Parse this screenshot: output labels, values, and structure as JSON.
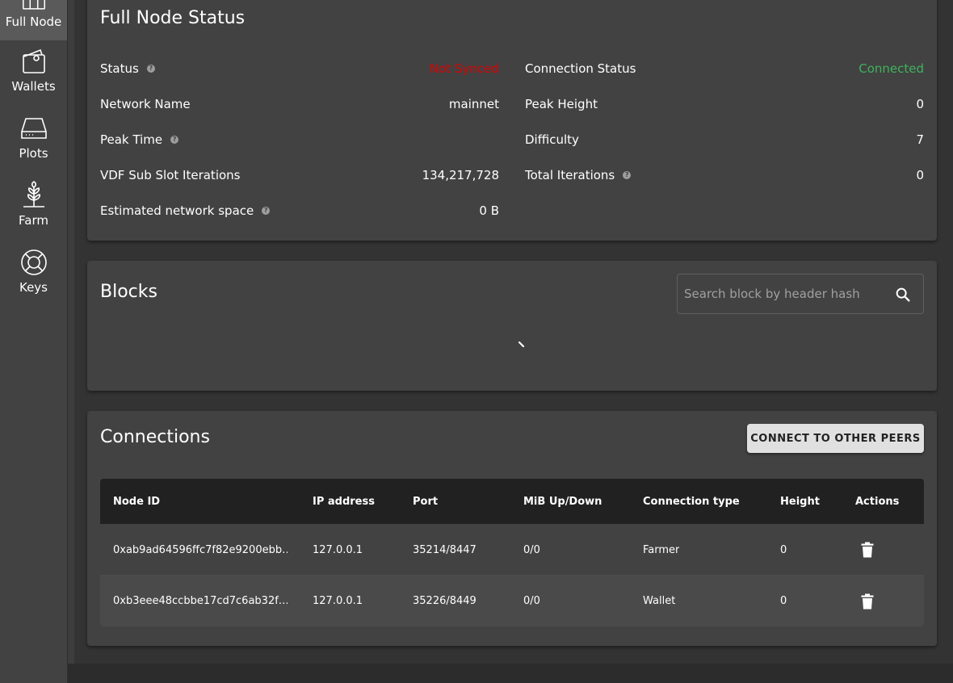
{
  "sidebar": {
    "items": [
      {
        "label": "Full Node",
        "icon": "full-node-icon",
        "active": true
      },
      {
        "label": "Wallets",
        "icon": "wallet-icon"
      },
      {
        "label": "Plots",
        "icon": "hard-drive-icon"
      },
      {
        "label": "Farm",
        "icon": "plant-icon"
      },
      {
        "label": "Keys",
        "icon": "lifebuoy-icon"
      }
    ]
  },
  "status_card": {
    "title": "Full Node Status",
    "left": [
      {
        "label": "Status",
        "value": "Not Synced",
        "help": true
      },
      {
        "label": "Network Name",
        "value": "mainnet"
      },
      {
        "label": "Peak Time",
        "value": "",
        "help": true
      },
      {
        "label": "VDF Sub Slot Iterations",
        "value": "134,217,728"
      },
      {
        "label": "Estimated network space",
        "value": "0 B",
        "help": true
      }
    ],
    "right": [
      {
        "label": "Connection Status",
        "value": "Connected"
      },
      {
        "label": "Peak Height",
        "value": "0"
      },
      {
        "label": "Difficulty",
        "value": "7"
      },
      {
        "label": "Total Iterations",
        "value": "0",
        "help": true
      }
    ],
    "colors": {
      "not_synced": "#e00000",
      "connected": "#3db35b"
    }
  },
  "blocks_card": {
    "title": "Blocks",
    "search_placeholder": "Search block by header hash"
  },
  "connections_card": {
    "title": "Connections",
    "connect_button": "CONNECT TO OTHER PEERS",
    "columns": [
      "Node ID",
      "IP address",
      "Port",
      "MiB Up/Down",
      "Connection type",
      "Height",
      "Actions"
    ],
    "rows": [
      {
        "node_id": "0xab9ad64596ffc7f82e9200ebb…",
        "ip": "127.0.0.1",
        "port": "35214/8447",
        "mib": "0/0",
        "type": "Farmer",
        "height": "0"
      },
      {
        "node_id": "0xb3eee48ccbbe17cd7c6ab32f…",
        "ip": "127.0.0.1",
        "port": "35226/8449",
        "mib": "0/0",
        "type": "Wallet",
        "height": "0"
      }
    ]
  }
}
